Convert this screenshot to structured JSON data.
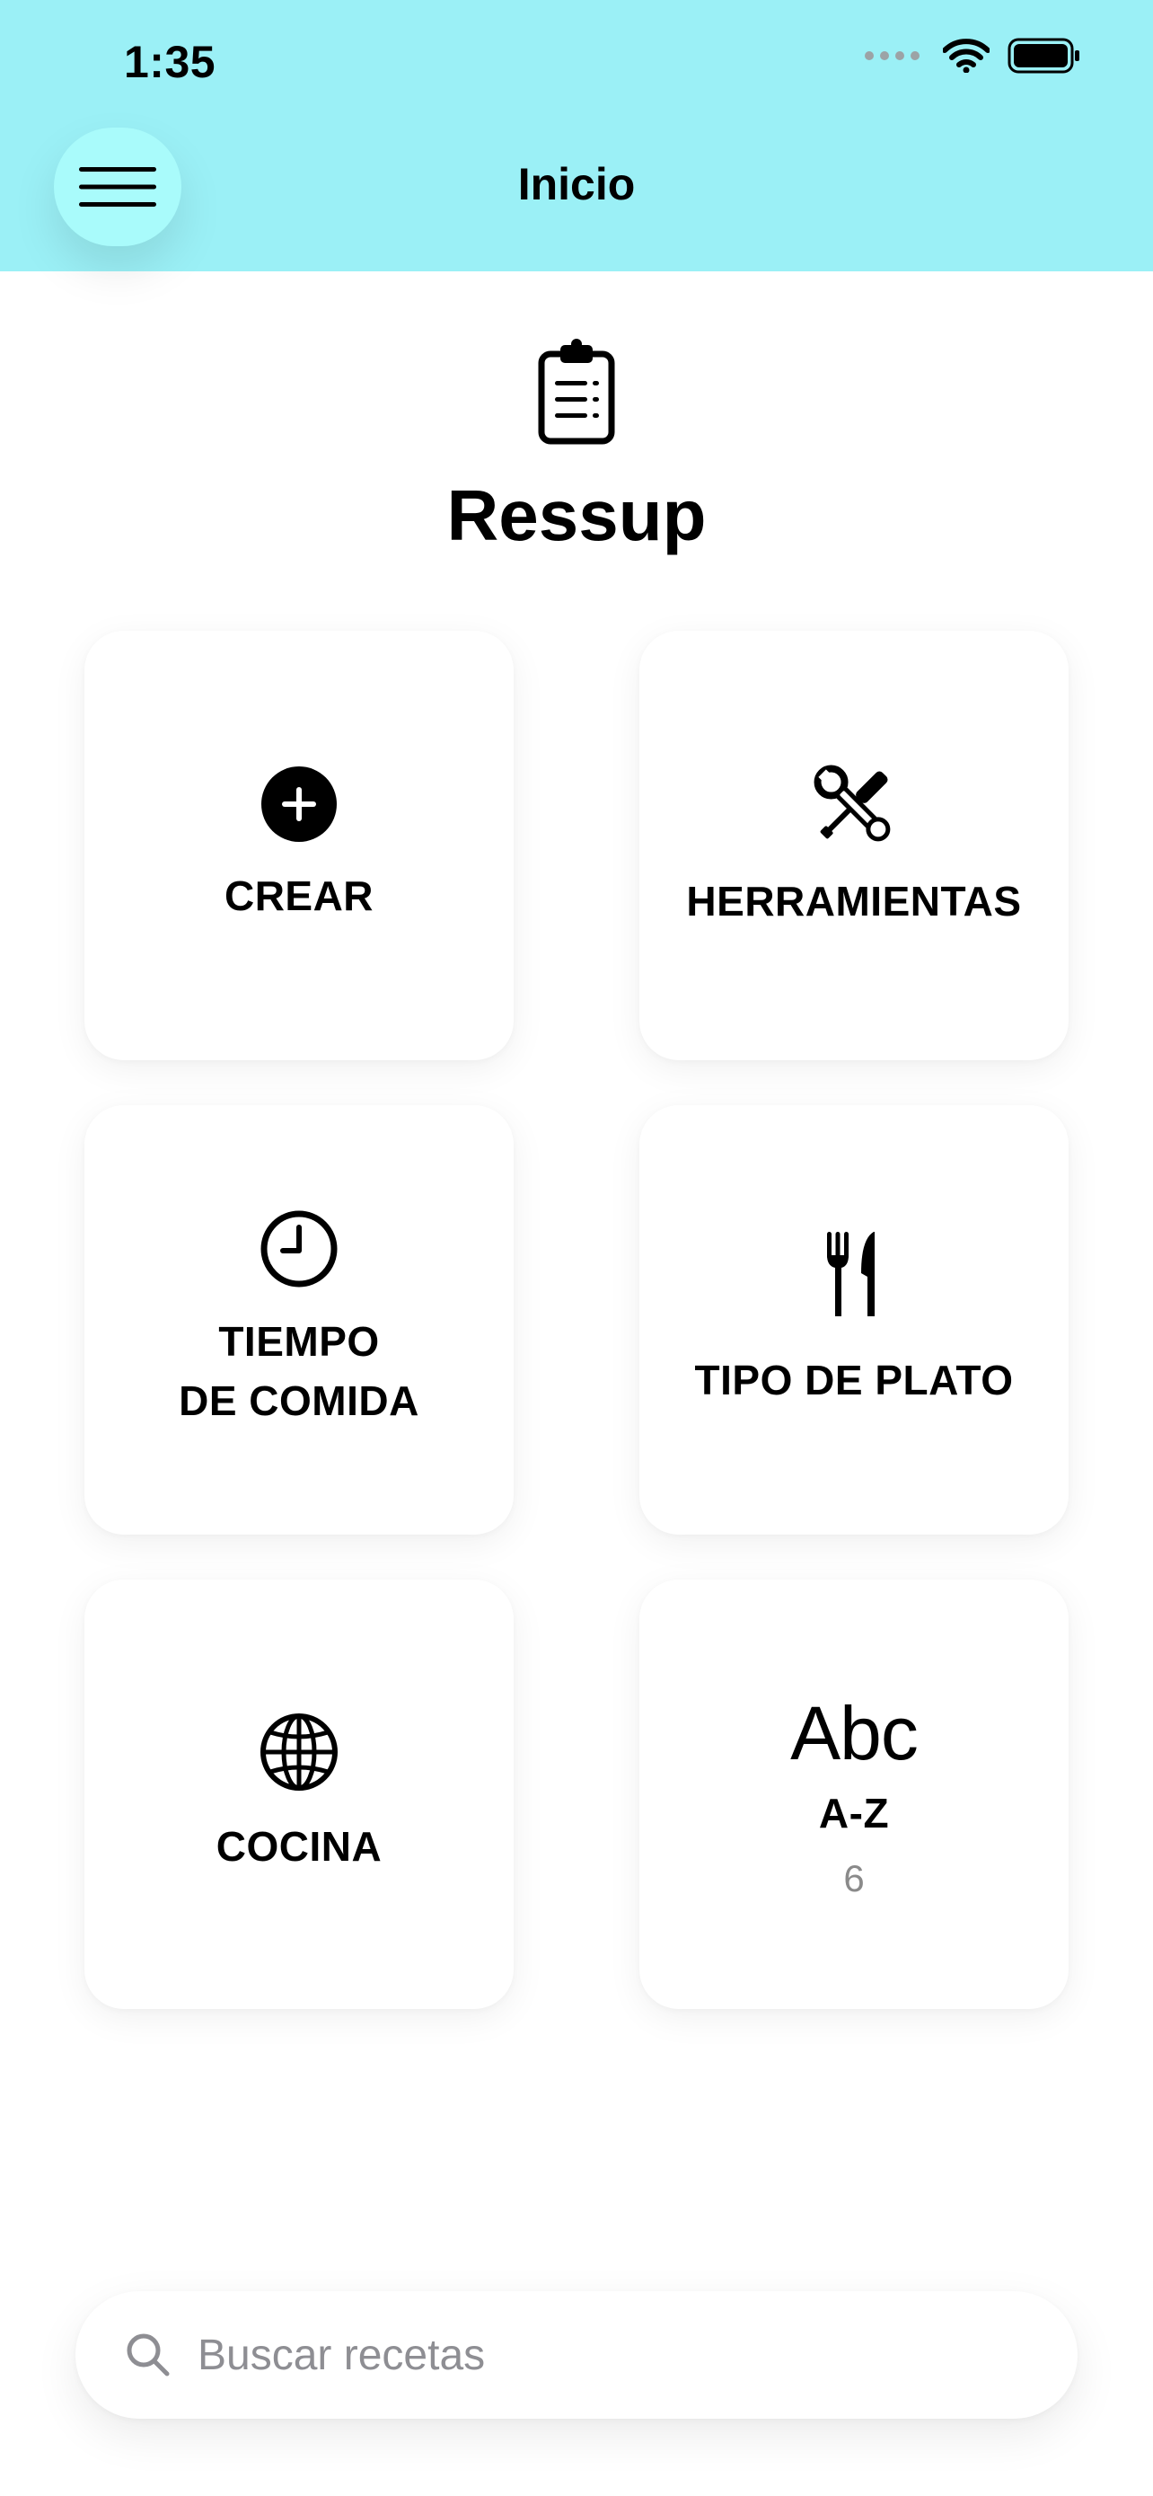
{
  "status_bar": {
    "time": "1:35"
  },
  "header": {
    "title": "Inicio",
    "menu_icon": "hamburger-icon"
  },
  "brand": {
    "icon": "clipboard-icon",
    "title": "Ressup"
  },
  "tiles": [
    {
      "icon": "plus-circle-icon",
      "label": "CREAR"
    },
    {
      "icon": "tools-icon",
      "label": "HERRAMIENTAS"
    },
    {
      "icon": "clock-icon",
      "label": "TIEMPO\nDE COMIDA"
    },
    {
      "icon": "fork-knife-icon",
      "label": "TIPO DE PLATO"
    },
    {
      "icon": "globe-icon",
      "label": "COCINA"
    },
    {
      "glyph": "Abc",
      "label": "A-Z",
      "count": "6"
    }
  ],
  "search": {
    "icon": "search-icon",
    "placeholder": "Buscar recetas",
    "value": ""
  },
  "colors": {
    "header_bg": "#9bf0f6",
    "menu_button_bg": "#a9fbfb",
    "background": "#ffffff"
  }
}
